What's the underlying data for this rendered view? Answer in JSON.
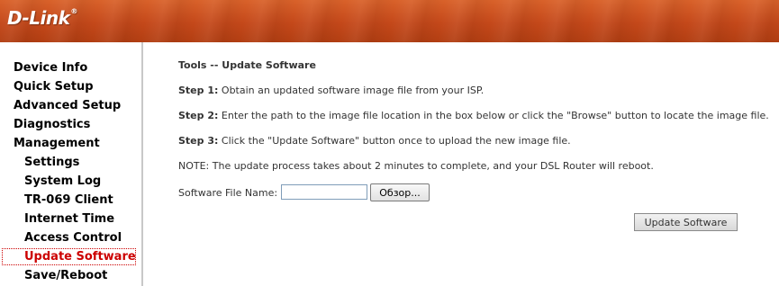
{
  "header": {
    "logo_text": "D-Link",
    "logo_mark": "®"
  },
  "sidebar": {
    "items": [
      {
        "label": "Device Info"
      },
      {
        "label": "Quick Setup"
      },
      {
        "label": "Advanced Setup"
      },
      {
        "label": "Diagnostics"
      },
      {
        "label": "Management"
      },
      {
        "label": "Settings"
      },
      {
        "label": "System Log"
      },
      {
        "label": "TR-069 Client"
      },
      {
        "label": "Internet Time"
      },
      {
        "label": "Access Control"
      },
      {
        "label": "Update Software"
      },
      {
        "label": "Save/Reboot"
      }
    ],
    "active_label": "Update Software"
  },
  "main": {
    "title": "Tools -- Update Software",
    "steps": [
      {
        "label": "Step 1:",
        "text": "Obtain an updated software image file from your ISP."
      },
      {
        "label": "Step 2:",
        "text": "Enter the path to the image file location in the box below or click the \"Browse\" button to locate the image file."
      },
      {
        "label": "Step 3:",
        "text": "Click the \"Update Software\" button once to upload the new image file."
      }
    ],
    "note": "NOTE: The update process takes about 2 minutes to complete, and your DSL Router will reboot.",
    "file_label": "Software File Name:",
    "file_value": "",
    "browse_label": "Обзор...",
    "update_button_label": "Update Software"
  },
  "colors": {
    "header": "#c4481a",
    "active_nav": "#cc0000",
    "body_text": "#333333"
  }
}
